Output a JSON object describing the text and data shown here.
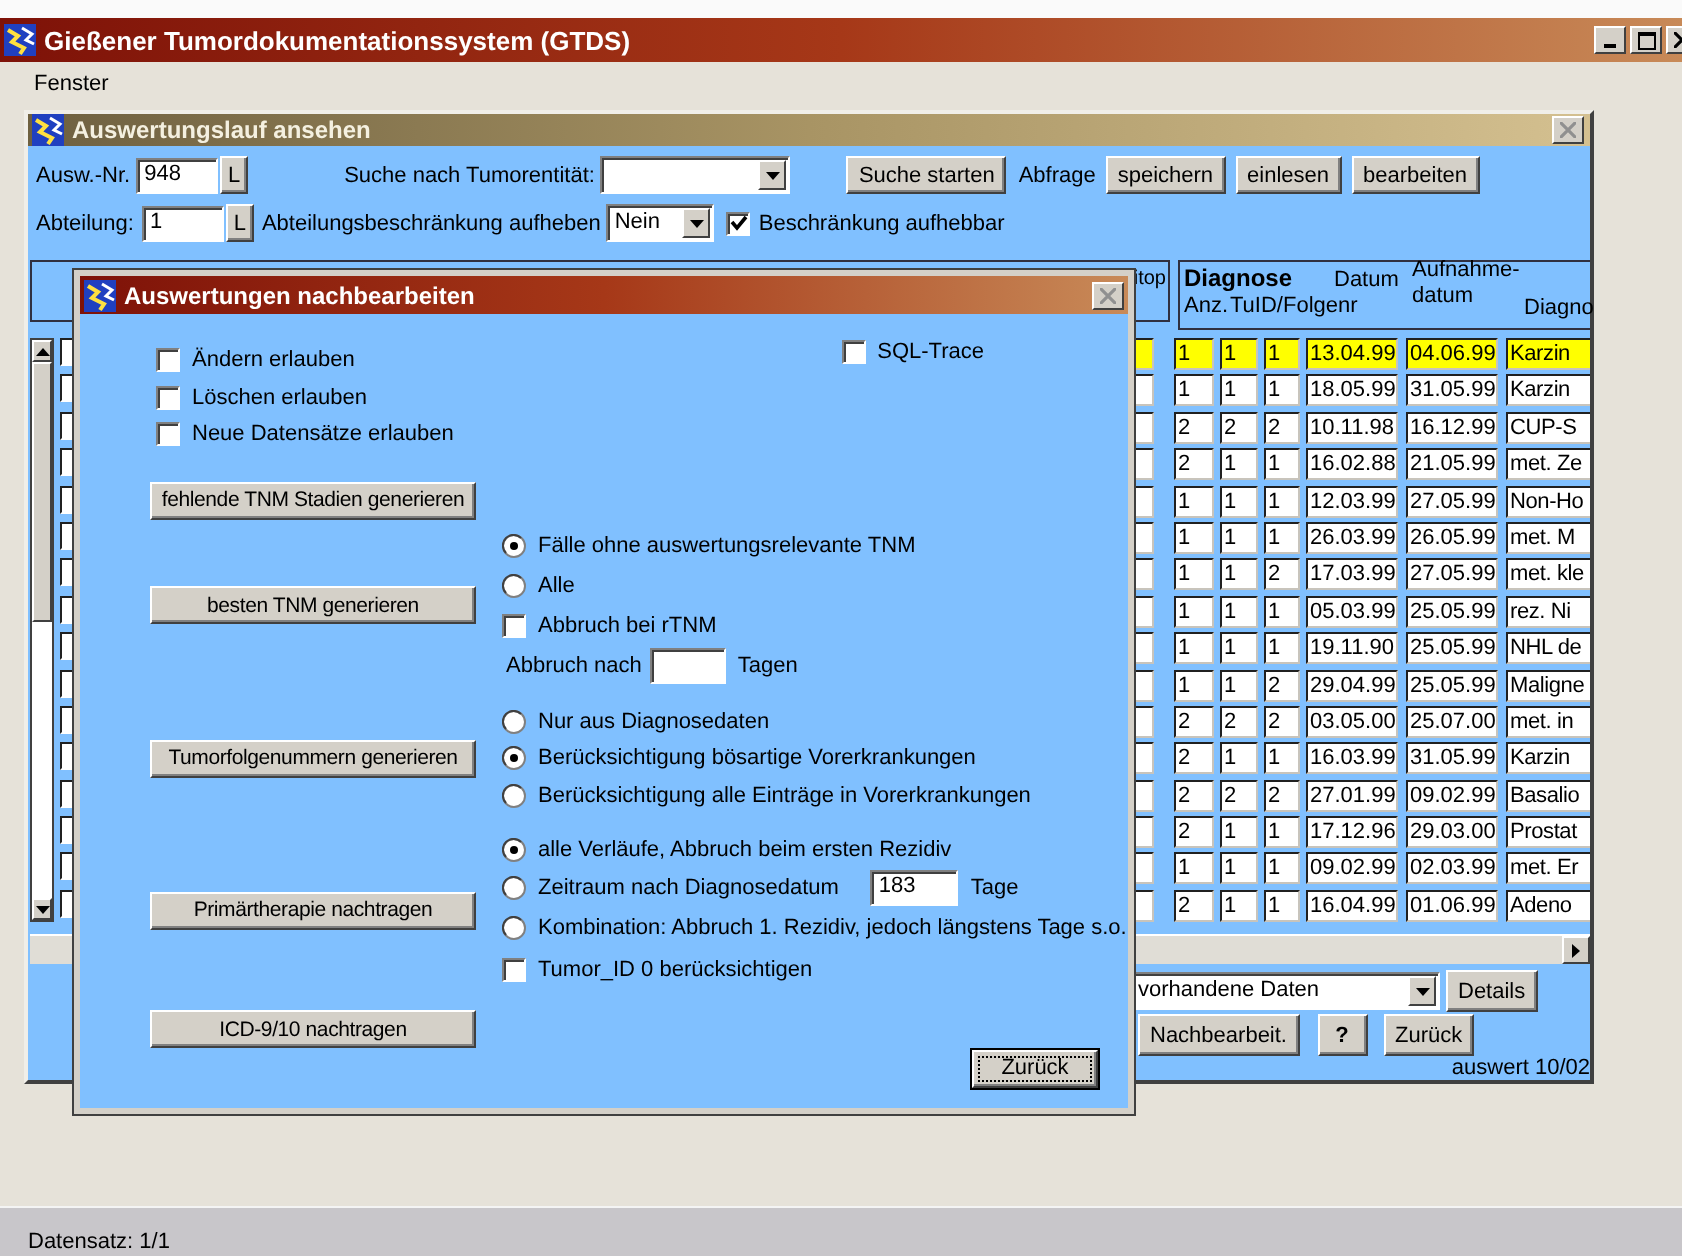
{
  "app_window": {
    "title": "Gießener Tumordokumentationssystem (GTDS)"
  },
  "menu": [
    {
      "label": "Fenster"
    }
  ],
  "evaluation_window": {
    "title": "Auswertungslauf ansehen",
    "run_number": {
      "label": "Ausw.-Nr.",
      "value": "948",
      "lookup": "L"
    },
    "tumor_search": {
      "label": "Suche nach Tumorentität:"
    },
    "search_button": "Suche starten",
    "query_label": "Abfrage",
    "query_buttons": [
      "speichern",
      "einlesen",
      "bearbeiten"
    ],
    "department": {
      "label": "Abteilung:",
      "value": "1",
      "lookup": "L"
    },
    "department_restriction": {
      "label": "Abteilungsbeschränkung aufheben",
      "value": "Nein"
    },
    "restriction_option": {
      "label": "Beschränkung aufhebbar",
      "checked": true
    },
    "table": {
      "cut_header": "itop",
      "header": {
        "group": "Diagnose",
        "count": "Anz.",
        "tumor_sequence": "TuID/Folgenr",
        "date": "Datum",
        "admission_date": "Aufnahme-\ndatum",
        "cut_column": "Diagno"
      },
      "rows": [
        {
          "checked": false,
          "selected": true,
          "cells": [
            "1",
            "1",
            "1",
            "13.04.99",
            "04.06.99",
            "Karzin"
          ]
        },
        {
          "checked": false,
          "selected": false,
          "cells": [
            "1",
            "1",
            "1",
            "18.05.99",
            "31.05.99",
            "Karzin"
          ]
        },
        {
          "checked": false,
          "selected": false,
          "cells": [
            "2",
            "2",
            "2",
            "10.11.98",
            "16.12.99",
            "CUP-S"
          ]
        },
        {
          "checked": false,
          "selected": false,
          "cells": [
            "2",
            "1",
            "1",
            "16.02.88",
            "21.05.99",
            "met. Ze"
          ]
        },
        {
          "checked": false,
          "selected": false,
          "cells": [
            "1",
            "1",
            "1",
            "12.03.99",
            "27.05.99",
            "Non-Ho"
          ]
        },
        {
          "checked": false,
          "selected": false,
          "cells": [
            "1",
            "1",
            "1",
            "26.03.99",
            "26.05.99",
            "met. M"
          ]
        },
        {
          "checked": false,
          "selected": false,
          "cells": [
            "1",
            "1",
            "2",
            "17.03.99",
            "27.05.99",
            "met. kle"
          ]
        },
        {
          "checked": false,
          "selected": false,
          "cells": [
            "1",
            "1",
            "1",
            "05.03.99",
            "25.05.99",
            "rez. Ni"
          ]
        },
        {
          "checked": false,
          "selected": false,
          "cells": [
            "1",
            "1",
            "1",
            "19.11.90",
            "25.05.99",
            "NHL de"
          ]
        },
        {
          "checked": false,
          "selected": false,
          "cells": [
            "1",
            "1",
            "2",
            "29.04.99",
            "25.05.99",
            "Maligne"
          ]
        },
        {
          "checked": false,
          "selected": false,
          "cells": [
            "2",
            "2",
            "2",
            "03.05.00",
            "25.07.00",
            "met. in"
          ]
        },
        {
          "checked": false,
          "selected": false,
          "cells": [
            "2",
            "1",
            "1",
            "16.03.99",
            "31.05.99",
            "Karzin"
          ]
        },
        {
          "checked": false,
          "selected": false,
          "cells": [
            "2",
            "2",
            "2",
            "27.01.99",
            "09.02.99",
            "Basalio"
          ]
        },
        {
          "checked": false,
          "selected": false,
          "cells": [
            "2",
            "1",
            "1",
            "17.12.96",
            "29.03.00",
            "Prostat"
          ]
        },
        {
          "checked": false,
          "selected": false,
          "cells": [
            "1",
            "1",
            "1",
            "09.02.99",
            "02.03.99",
            "met. Er"
          ]
        },
        {
          "checked": false,
          "selected": false,
          "cells": [
            "2",
            "1",
            "1",
            "16.04.99",
            "01.06.99",
            "Adeno"
          ]
        }
      ]
    },
    "filter": {
      "value": "vorhandene Daten"
    },
    "details_button": "Details",
    "buttons": [
      "Nachbearbeit.",
      "?",
      "Zurück"
    ],
    "version": "auswert 10/02"
  },
  "dialog": {
    "title": "Auswertungen nachbearbeiten",
    "permissions": [
      {
        "label": "Ändern erlauben",
        "checked": false
      },
      {
        "label": "Löschen erlauben",
        "checked": false
      },
      {
        "label": "Neue Datensätze erlauben",
        "checked": false
      }
    ],
    "sql_trace": {
      "label": "SQL-Trace",
      "checked": false
    },
    "sections": [
      {
        "button": "fehlende TNM Stadien generieren"
      },
      {
        "button": "besten TNM generieren",
        "options": [
          {
            "kind": "radio",
            "label": "Fälle ohne auswertungsrelevante TNM",
            "selected": true
          },
          {
            "kind": "radio",
            "label": "Alle",
            "selected": false
          },
          {
            "kind": "checkbox",
            "label": "Abbruch bei rTNM",
            "checked": false
          },
          {
            "kind": "field",
            "label": "Abbruch nach",
            "suffix": "Tagen"
          }
        ]
      },
      {
        "button": "Tumorfolgenummern generieren",
        "options": [
          {
            "kind": "radio",
            "label": "Nur aus Diagnosedaten",
            "selected": false
          },
          {
            "kind": "radio",
            "label": "Berücksichtigung bösartige Vorerkrankungen",
            "selected": true
          },
          {
            "kind": "radio",
            "label": "Berücksichtigung alle Einträge in Vorerkrankungen",
            "selected": false
          }
        ]
      },
      {
        "button": "Primärtherapie nachtragen",
        "options": [
          {
            "kind": "radio",
            "label": "alle Verläufe, Abbruch beim ersten Rezidiv",
            "selected": true
          },
          {
            "kind": "radio_field",
            "label": "Zeitraum nach Diagnosedatum",
            "value": "183",
            "suffix": "Tage",
            "selected": false
          },
          {
            "kind": "radio",
            "label": "Kombination: Abbruch 1. Rezidiv, jedoch längstens Tage s.o.",
            "selected": false
          },
          {
            "kind": "checkbox",
            "label": "Tumor_ID 0 berücksichtigen",
            "checked": false
          }
        ]
      },
      {
        "button": "ICD-9/10 nachtragen"
      }
    ],
    "close_button": "Zurück"
  },
  "status_bar": "Datensatz: 1/1"
}
